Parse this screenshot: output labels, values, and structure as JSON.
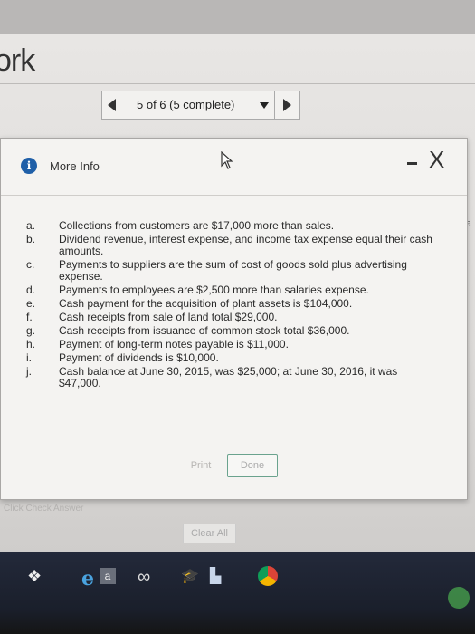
{
  "app": {
    "title": "ork"
  },
  "pager": {
    "label": "5 of 6 (5 complete)"
  },
  "modal": {
    "title": "More Info",
    "close_label": "X",
    "items": [
      {
        "letter": "a.",
        "text": "Collections from customers are $17,000 more than sales."
      },
      {
        "letter": "b.",
        "text": "Dividend revenue, interest expense, and income tax expense equal their cash amounts."
      },
      {
        "letter": "c.",
        "text": "Payments to suppliers are the sum of cost of goods sold plus advertising expense."
      },
      {
        "letter": "d.",
        "text": "Payments to employees are $2,500 more than salaries expense."
      },
      {
        "letter": "e.",
        "text": "Cash payment for the acquisition of plant assets is $104,000."
      },
      {
        "letter": "f.",
        "text": "Cash receipts from sale of land total $29,000."
      },
      {
        "letter": "g.",
        "text": "Cash receipts from issuance of common stock total $36,000."
      },
      {
        "letter": "h.",
        "text": "Payment of long-term notes payable is $11,000."
      },
      {
        "letter": "i.",
        "text": "Payment of dividends is $10,000."
      },
      {
        "letter": "j.",
        "text": "Cash balance at June 30, 2015, was $25,000; at June 30, 2016, it was $47,000."
      }
    ],
    "print_label": "Print",
    "done_label": "Done"
  },
  "background": {
    "right_edge_text": "tra",
    "left_edge_number": "0",
    "check_answer_label": "Click Check Answer",
    "clear_all_label": "Clear All"
  },
  "taskbar": {
    "icons": [
      "dropbox-icon",
      "internet-explorer-icon",
      "a-app-icon",
      "infinity-icon",
      "graduation-cap-icon",
      "book-icon",
      "chrome-icon"
    ],
    "a_label": "a"
  },
  "colors": {
    "info_icon": "#1f5fa8",
    "done_border": "#6aa38e",
    "taskbar": "#1a1f2b"
  }
}
